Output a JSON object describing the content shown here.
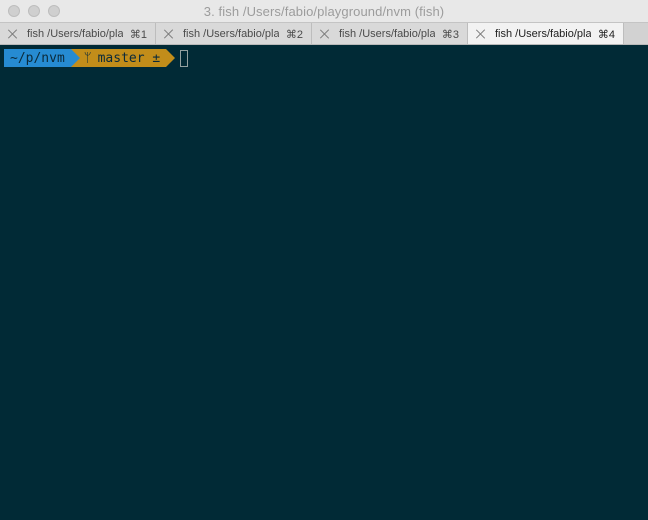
{
  "window": {
    "title": "3. fish  /Users/fabio/playground/nvm (fish)"
  },
  "tabs": [
    {
      "label": "fish  /Users/fabio/playground/nvm",
      "shortcut": "⌘1",
      "active": false
    },
    {
      "label": "fish  /Users/fabio/playground/nvm",
      "shortcut": "⌘2",
      "active": false
    },
    {
      "label": "fish  /Users/fabio/playground/nvm",
      "shortcut": "⌘3",
      "active": false
    },
    {
      "label": "fish  /Users/fabio/playground/nvm",
      "shortcut": "⌘4",
      "active": true
    }
  ],
  "prompt": {
    "cwd": "~/p/nvm",
    "branch_icon": "git-branch-icon",
    "branch_glyph": "ᛘ",
    "branch": "master ±"
  },
  "colors": {
    "terminal_bg": "#012a36",
    "cwd_segment": "#268bd2",
    "git_segment": "#c28d1a"
  }
}
